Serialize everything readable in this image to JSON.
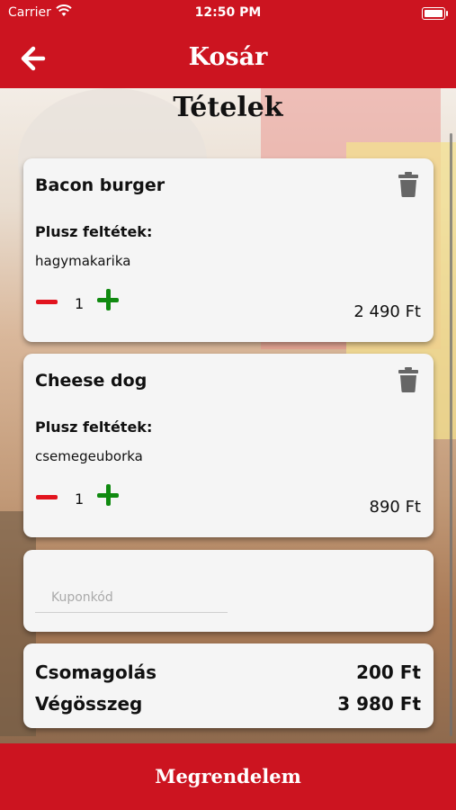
{
  "status": {
    "carrier": "Carrier",
    "time": "12:50 PM"
  },
  "header": {
    "title": "Kosár",
    "back_icon": "arrow-left-icon"
  },
  "section_title": "Tételek",
  "items": [
    {
      "name": "Bacon burger",
      "extras_label": "Plusz feltétek:",
      "extras": "hagymakarika",
      "quantity": "1",
      "price": "2 490 Ft"
    },
    {
      "name": "Cheese dog",
      "extras_label": "Plusz feltétek:",
      "extras": "csemegeuborka",
      "quantity": "1",
      "price": "890 Ft"
    }
  ],
  "coupon": {
    "placeholder": "Kuponkód",
    "value": ""
  },
  "summary": {
    "packaging_label": "Csomagolás",
    "packaging_value": "200 Ft",
    "total_label": "Végösszeg",
    "total_value": "3 980 Ft"
  },
  "order_button": "Megrendelem",
  "colors": {
    "brand_red": "#cc1420",
    "minus_red": "#e2141e",
    "plus_green": "#108a10"
  }
}
